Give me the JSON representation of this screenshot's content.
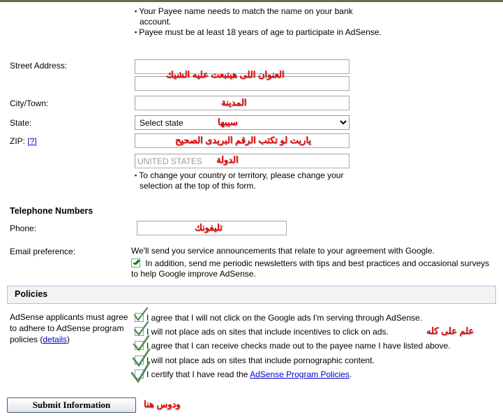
{
  "top_notes": {
    "line1": "Your Payee name needs to match the name on your bank account.",
    "line2": "Payee must be at least 18 years of age to participate in AdSense."
  },
  "fields": {
    "street_label": "Street Address:",
    "street_line1_value": "",
    "street_line2_value": "",
    "city_label": "City/Town:",
    "city_value": "",
    "state_label": "State:",
    "state_selected": "Select state",
    "zip_label": "ZIP:",
    "zip_help_link": "[?]",
    "zip_value": "",
    "country_value": "UNITED STATES",
    "country_note": "To change your country or territory, please change your selection at the top of this form."
  },
  "telephone": {
    "section_title": "Telephone Numbers",
    "phone_label": "Phone:",
    "phone_value": ""
  },
  "email": {
    "label": "Email preference:",
    "intro": "We'll send you service announcements that relate to your agreement with Google.",
    "newsletter_text": "In addition, send me periodic newsletters with tips and best practices and occasional surveys to help Google improve AdSense.",
    "newsletter_checked": true
  },
  "policies": {
    "panel_title": "Policies",
    "left_text_before_link": "AdSense applicants must agree to adhere to AdSense program policies (",
    "details_link": "details",
    "left_text_after_link": ")",
    "items": [
      {
        "text": "I agree that I will not click on the Google ads I'm serving through AdSense.",
        "checked": false
      },
      {
        "text": "I will not place ads on sites that include incentives to click on ads.",
        "checked": false
      },
      {
        "text": "I agree that I can receive checks made out to the payee name I have listed above.",
        "checked": false
      },
      {
        "text": "I will not place ads on sites that include pornographic content.",
        "checked": false
      }
    ],
    "certify_prefix": "I certify that I have read the ",
    "certify_link": "AdSense Program Policies",
    "certify_suffix": "."
  },
  "submit": {
    "label": "Submit Information"
  },
  "annotations": {
    "street": "العنوان اللى هيتبعت عليه الشيك",
    "city": "المدينة",
    "state": "سيبها",
    "zip": "ياريت لو تكتب الرقم البريدى الصحيح",
    "country": "الدولة",
    "phone": "تليفونك",
    "policies": "علم على كله",
    "submit": "ودوس هنا"
  },
  "colors": {
    "annotation_red": "#e00000",
    "link_blue": "#0000cc",
    "checkbox_border": "#7f9db9",
    "hand_tick_green": "#4f8a4f",
    "top_bar": "#6b6a55",
    "panel_border": "#a7c3e0"
  }
}
